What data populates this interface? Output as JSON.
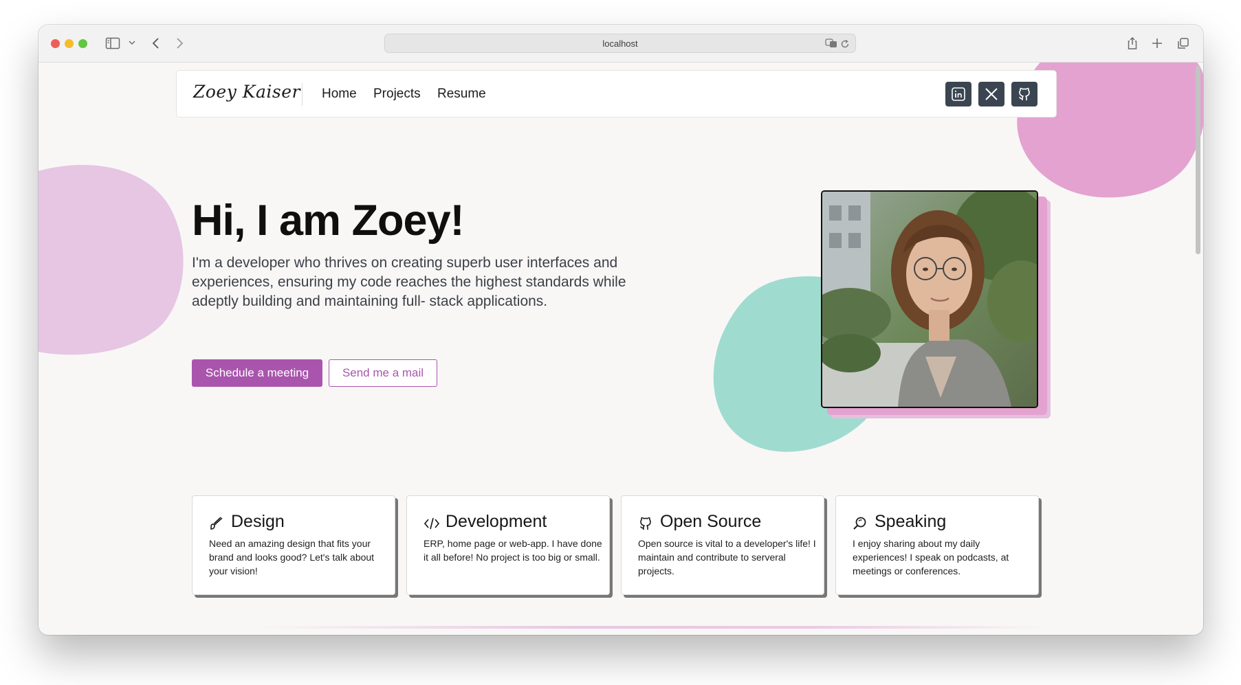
{
  "browser": {
    "url": "localhost",
    "sidebar_icon": "sidebar-icon",
    "colors": {
      "close": "#ee5e55",
      "minimize": "#f5bd2e",
      "maximize": "#5ec73f"
    }
  },
  "nav": {
    "brand": "Zoey Kaiser",
    "links": [
      "Home",
      "Projects",
      "Resume"
    ],
    "social": [
      "linkedin-icon",
      "x-icon",
      "github-icon"
    ]
  },
  "hero": {
    "title": "Hi, I am Zoey!",
    "text": "I'm a developer who thrives on creating superb user interfaces and experiences, ensuring my code reaches the highest standards while adeptly building and maintaining full- stack applications.",
    "primary_button": "Schedule a meeting",
    "secondary_button": "Send me a mail"
  },
  "cards": [
    {
      "icon": "brush-icon",
      "title": "Design",
      "text": "Need an amazing design that fits your brand and looks good? Let's talk about your vision!"
    },
    {
      "icon": "code-icon",
      "title": "Development",
      "text": "ERP, home page or web-app. I have done it all before! No project is too big or small."
    },
    {
      "icon": "github-icon",
      "title": "Open Source",
      "text": "Open source is vital to a developer's life! I maintain and contribute to serveral projects."
    },
    {
      "icon": "search-icon",
      "title": "Speaking",
      "text": "I enjoy sharing about my daily experiences! I speak on podcasts, at meetings or conferences."
    }
  ],
  "colors": {
    "accent": "#a955ad",
    "blob_pink": "#e3a2d0",
    "blob_lilac": "#e6c6e3",
    "blob_teal": "#a0dbd0",
    "social_bg": "#3b4552"
  }
}
